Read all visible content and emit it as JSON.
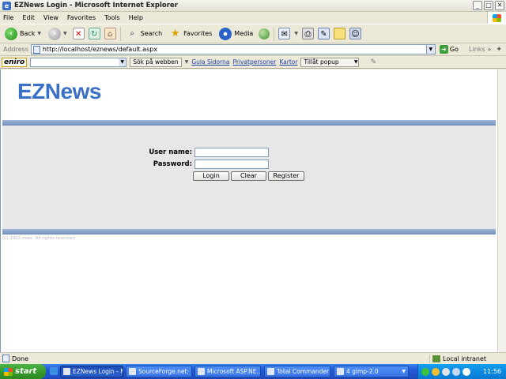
{
  "window": {
    "title": "EZNews Login - Microsoft Internet Explorer"
  },
  "menu": [
    "File",
    "Edit",
    "View",
    "Favorites",
    "Tools",
    "Help"
  ],
  "toolbar": {
    "back": "Back",
    "search": "Search",
    "favorites": "Favorites",
    "media": "Media"
  },
  "address": {
    "label": "Address",
    "url": "http://localhost/eznews/default.aspx",
    "go": "Go",
    "links": "Links"
  },
  "eniro": {
    "logo": "eniro",
    "search_button": "Sök på webben",
    "links": [
      "Gula Sidorna",
      "Privatpersoner",
      "Kartor"
    ],
    "popup": "Tillåt popup"
  },
  "page": {
    "logo": "EZNews",
    "username_label": "User name:",
    "password_label": "Password:",
    "username_value": "",
    "password_value": "",
    "buttons": {
      "login": "Login",
      "clear": "Clear",
      "register": "Register"
    },
    "footer": "(c) 2003 mike. All rights reserved"
  },
  "status": {
    "text": "Done",
    "zone": "Local intranet"
  },
  "taskbar": {
    "start": "start",
    "tasks": [
      {
        "label": "EZNews Login - Mi...",
        "active": true
      },
      {
        "label": "SourceForge.net: ...",
        "active": false
      },
      {
        "label": "Microsoft ASP.NE...",
        "active": false
      },
      {
        "label": "Total Commander ...",
        "active": false
      },
      {
        "label": "4 gimp-2.0",
        "active": false
      }
    ],
    "clock": "11:56"
  },
  "colors": {
    "logo": "#3a6fc8",
    "band": "#7f9fc6",
    "panel": "#e7e7e7",
    "taskbar": "#2458d6",
    "start": "#379a2c"
  }
}
